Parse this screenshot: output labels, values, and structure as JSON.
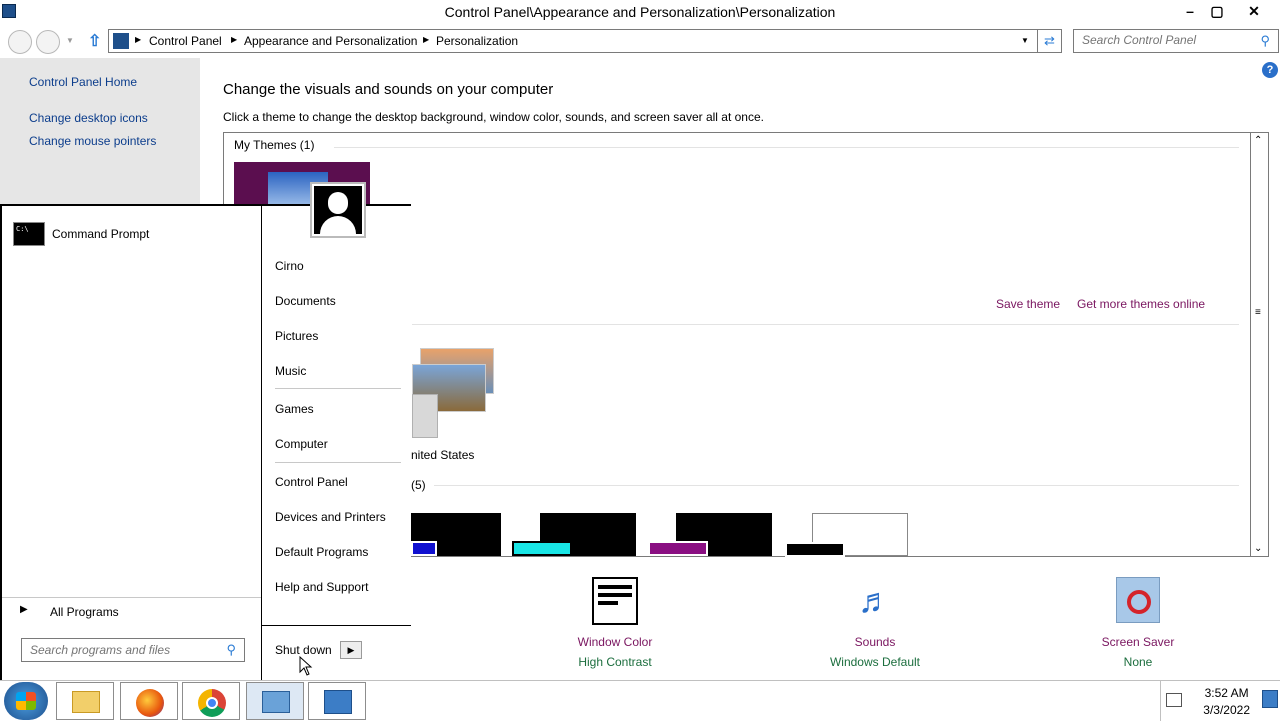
{
  "window": {
    "title": "Control Panel\\Appearance and Personalization\\Personalization",
    "minimize": "–",
    "maximize": "▢",
    "close": "✕"
  },
  "address": {
    "crumbs": [
      "Control Panel",
      "Appearance and Personalization",
      "Personalization"
    ],
    "search_placeholder": "Search Control Panel"
  },
  "sidebar": {
    "items": [
      {
        "label": "Control Panel Home"
      },
      {
        "label": "Change desktop icons"
      },
      {
        "label": "Change mouse pointers"
      }
    ]
  },
  "main": {
    "title": "Change the visuals and sounds on your computer",
    "subtitle": "Click a theme to change the desktop background, window color, sounds, and screen saver all at once.",
    "my_themes_label": "My Themes (1)",
    "save_theme": "Save theme",
    "get_more_themes": "Get more themes online",
    "installed_theme_label": "nited States",
    "high_contrast_label": "(5)"
  },
  "bottom": {
    "window_color": {
      "label": "Window Color",
      "value": "High Contrast"
    },
    "sounds": {
      "label": "Sounds",
      "value": "Windows Default"
    },
    "screen_saver": {
      "label": "Screen Saver",
      "value": "None"
    }
  },
  "start_menu": {
    "pinned": [
      {
        "label": "Command Prompt"
      }
    ],
    "all_programs": "All Programs",
    "search_placeholder": "Search programs and files",
    "right_items": [
      "Cirno",
      "Documents",
      "Pictures",
      "Music",
      "Games",
      "Computer",
      "Control Panel",
      "Devices and Printers",
      "Default Programs",
      "Help and Support"
    ],
    "shutdown": "Shut down"
  },
  "taskbar": {
    "time": "3:52 AM",
    "date": "3/3/2022"
  },
  "colors": {
    "link_blue": "#0c3d8c",
    "link_purple": "#7a1660",
    "sub_green": "#1c6e3e",
    "theme_purple": "#5b0e4f"
  }
}
